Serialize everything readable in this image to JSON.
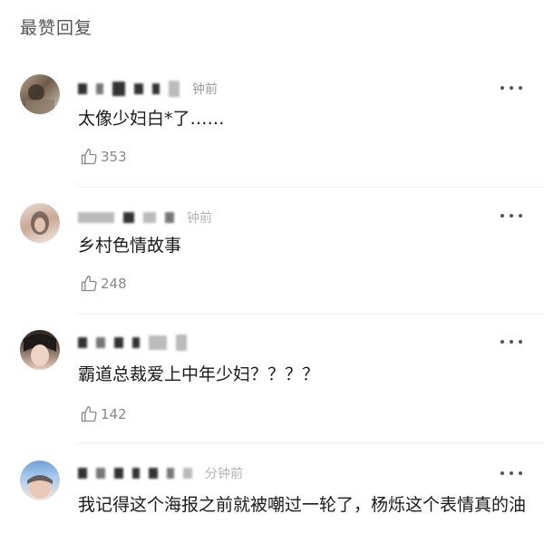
{
  "section_title": "最赞回复",
  "comments": [
    {
      "time": "钟前",
      "text": "太像少妇白*了……",
      "likes": "353"
    },
    {
      "time": "钟前",
      "text": "乡村色情故事",
      "likes": "248"
    },
    {
      "time": "",
      "text": "霸道总裁爱上中年少妇？？？？",
      "likes": "142"
    },
    {
      "time": "分钟前",
      "text": "我记得这个海报之前就被嘲过一轮了，杨烁这个表情真的油",
      "likes": ""
    }
  ],
  "colors": {
    "background": "#ffffff",
    "text": "#1a1a1a",
    "meta": "#9a9a9a",
    "divider": "#ececec"
  },
  "icons": {
    "more": "more-dots-icon",
    "like": "thumb-up-icon"
  }
}
